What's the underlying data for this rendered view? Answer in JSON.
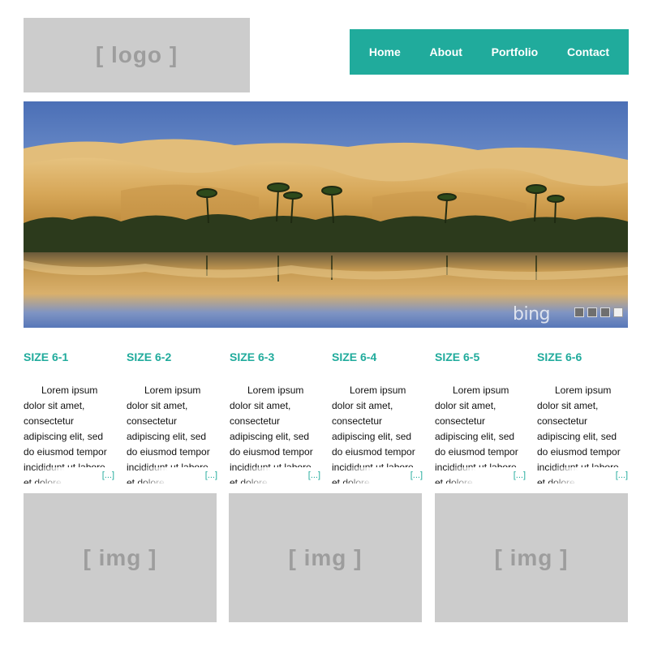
{
  "header": {
    "logo_text": "[ logo ]",
    "nav": [
      "Home",
      "About",
      "Portfolio",
      "Contact"
    ],
    "accent_color": "#20ab9c"
  },
  "hero": {
    "watermark": "bing",
    "slides": 4,
    "active_slide": 4
  },
  "columns": [
    {
      "title": "SIZE 6-1",
      "body": "Lorem ipsum dolor sit amet, consectetur adipiscing elit, sed do eiusmod tempor incididunt ut labore et dolore",
      "more": "[...]"
    },
    {
      "title": "SIZE 6-2",
      "body": "Lorem ipsum dolor sit amet, consectetur adipiscing elit, sed do eiusmod tempor incididunt ut labore et dolore",
      "more": "[...]"
    },
    {
      "title": "SIZE 6-3",
      "body": "Lorem ipsum dolor sit amet, consectetur adipiscing elit, sed do eiusmod tempor incididunt ut labore et dolore",
      "more": "[...]"
    },
    {
      "title": "SIZE 6-4",
      "body": "Lorem ipsum dolor sit amet, consectetur adipiscing elit, sed do eiusmod tempor incididunt ut labore et dolore",
      "more": "[...]"
    },
    {
      "title": "SIZE 6-5",
      "body": "Lorem ipsum dolor sit amet, consectetur adipiscing elit, sed do eiusmod tempor incididunt ut labore et dolore",
      "more": "[...]"
    },
    {
      "title": "SIZE 6-6",
      "body": "Lorem ipsum dolor sit amet, consectetur adipiscing elit, sed do eiusmod tempor incididunt ut labore et dolore",
      "more": "[...]"
    }
  ],
  "images": [
    "[ img ]",
    "[ img ]",
    "[ img ]"
  ]
}
